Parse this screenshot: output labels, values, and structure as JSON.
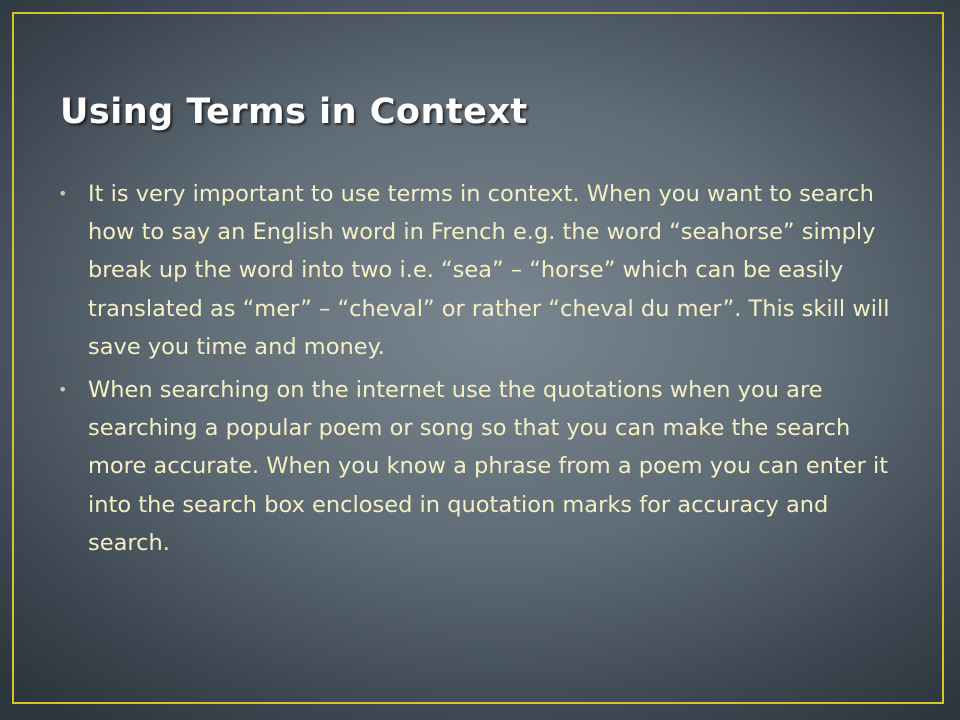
{
  "slide": {
    "title": "Using Terms in Context",
    "bullets": [
      {
        "marker": "•",
        "text": "It is very important to use terms in context. When you want to search how to say an English word in French e.g. the word “seahorse” simply break up the word into two i.e. “sea” – “horse” which can be easily translated as “mer” – “cheval” or rather “cheval du mer”. This skill will save you time and money."
      },
      {
        "marker": "•",
        "text": "When searching on the internet use the quotations when you are searching a popular poem or song so that you can make the search more accurate. When you know a phrase from a poem you can enter it into the search box enclosed in quotation marks for accuracy and search."
      }
    ]
  },
  "colors": {
    "frame": "#d4c52e",
    "title": "#ffffff",
    "body_text": "#f2f0c4",
    "background": "#5f6b75"
  }
}
